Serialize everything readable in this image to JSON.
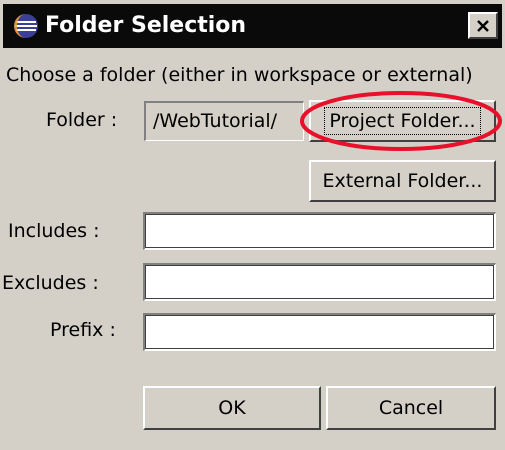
{
  "window": {
    "title": "Folder Selection",
    "close_glyph": "✕"
  },
  "form": {
    "instruction": "Choose a folder (either in workspace or external)",
    "folder_label": "Folder :",
    "folder_value": "/WebTutorial/",
    "project_folder_button": "Project Folder...",
    "external_folder_button": "External Folder...",
    "includes_label": "Includes :",
    "includes_value": "",
    "excludes_label": "Excludes :",
    "excludes_value": "",
    "prefix_label": "Prefix :",
    "prefix_value": ""
  },
  "buttons": {
    "ok": "OK",
    "cancel": "Cancel"
  },
  "icons": {
    "app": "eclipse-icon",
    "close": "close-icon"
  },
  "colors": {
    "dialog_background": "#d4d0c8",
    "title_bar": "#0a0a0a",
    "highlight": "#e8102a"
  }
}
